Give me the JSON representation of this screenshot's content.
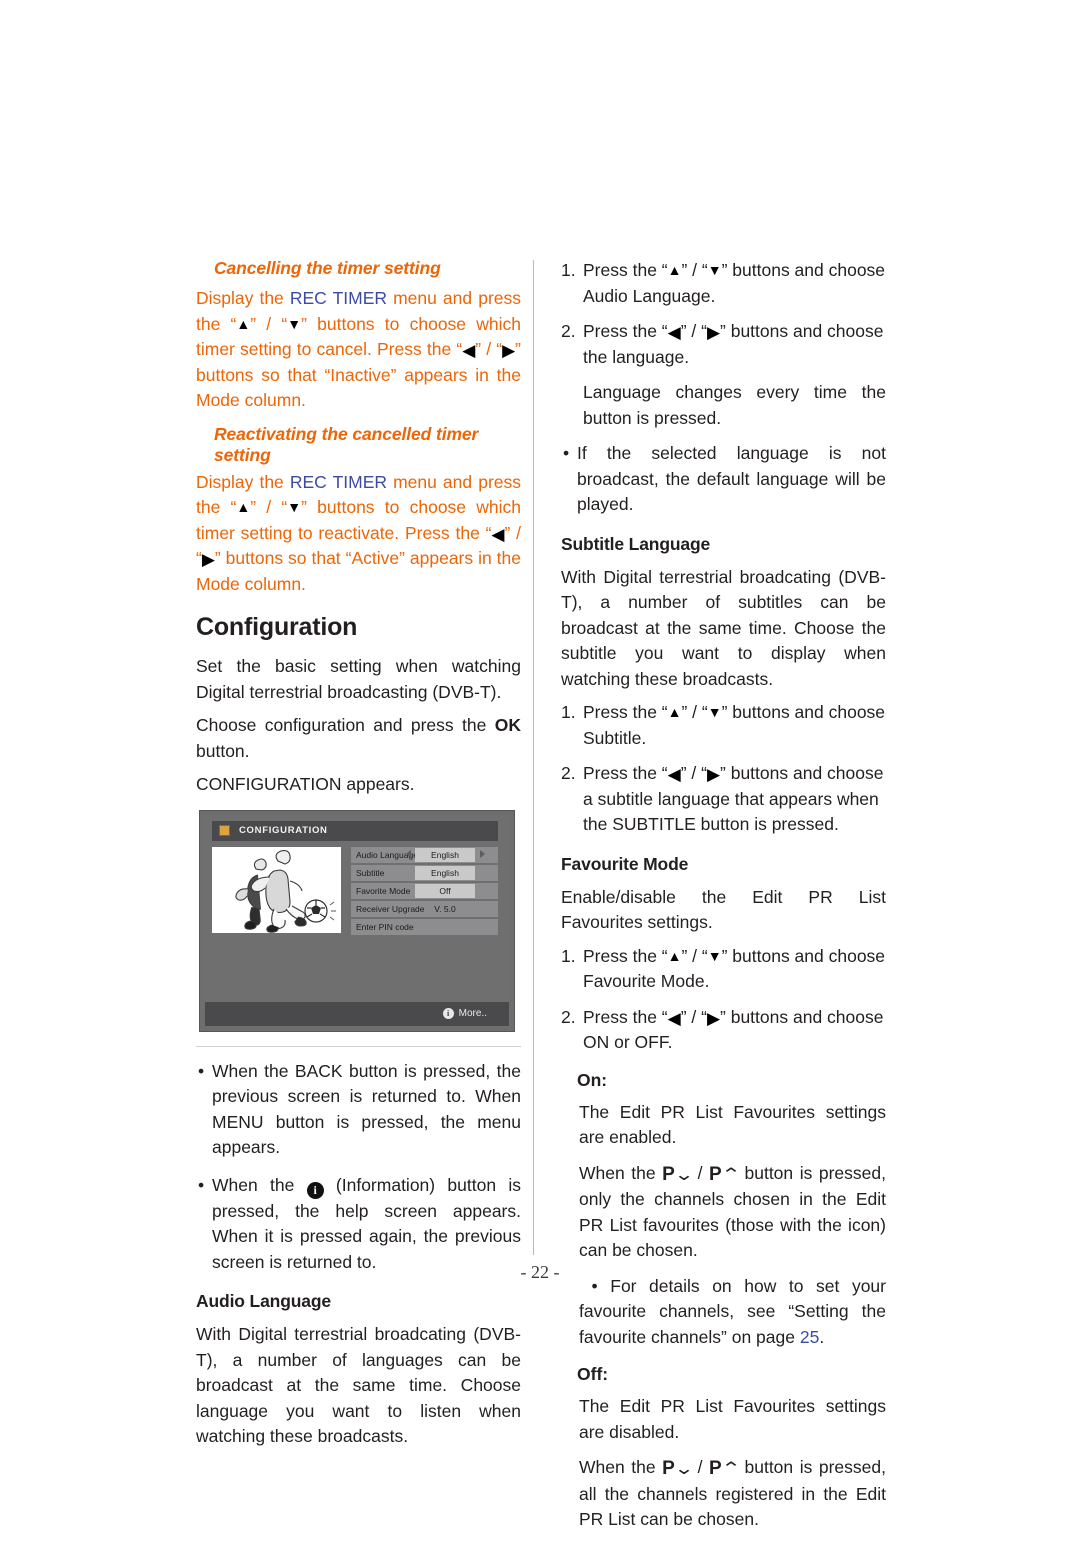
{
  "page": {
    "number_label": "- 22 -"
  },
  "left_column": {
    "cancel_heading": "Cancelling the timer setting",
    "cancel_body": {
      "p1": "Display the ",
      "rec_timer": "REC TIMER",
      "p2": " menu and press the “",
      "p3": "” / “",
      "p4": "” buttons to choose which timer setting to cancel. Press the “",
      "p5": "” / “",
      "p6": "” buttons so that “Inactive” appears in the Mode column."
    },
    "reactivate_heading": "Reactivating the cancelled  timer setting",
    "reactivate_body": {
      "p1": "Display the ",
      "rec_timer": "REC TIMER",
      "p2": " menu and press the “",
      "p3": "” / “",
      "p4": "” buttons to choose which timer setting to reactivate. Press the “",
      "p5": "” / “",
      "p6": "” buttons so that “Active” appears in the Mode column."
    },
    "configuration_title": "Configuration",
    "config_p1": "Set the basic setting when watching Digital terrestrial broadcasting (DVB-T).",
    "config_p2_a": "Choose configuration and press the ",
    "config_p2_ok": "OK",
    "config_p2_b": " button.",
    "config_p3": "CONFIGURATION appears.",
    "bullet_back_a": "When the BACK button is pressed, the previous screen is returned to. When MENU button is pressed, the menu appears.",
    "bullet_info_a": "When the ",
    "bullet_info_b": " (Information) button is pressed, the help screen appears. When it is pressed again, the previous screen is returned to.",
    "audio_language_heading": "Audio Language",
    "audio_language_body": "With Digital terrestrial broadcating (DVB-T), a number of languages can be broadcast at the same time. Choose language you want to listen when watching these broadcasts."
  },
  "screenshot": {
    "title": "CONFIGURATION",
    "title_icon": "key-icon",
    "rows": [
      {
        "label": "Audio Language",
        "value": "English",
        "has_arrows": true,
        "value_boxed": true
      },
      {
        "label": "Subtitle",
        "value": "English",
        "has_arrows": false,
        "value_boxed": true
      },
      {
        "label": "Favorite Mode",
        "value": "Off",
        "has_arrows": false,
        "value_boxed": true
      },
      {
        "label": "Receiver Upgrade",
        "value": "V. 5.0",
        "has_arrows": false,
        "value_boxed": false
      },
      {
        "label": "Enter PIN code",
        "value": "",
        "has_arrows": false,
        "value_boxed": false
      }
    ],
    "footer_label": "More..",
    "footer_icon": "info-icon",
    "artwork": "soccer-players-line-art"
  },
  "right_column": {
    "audio_step1_n": "1.",
    "audio_step1_a": "Press the “",
    "audio_step1_b": "” / “",
    "audio_step1_c": "” buttons and choose Audio Language.",
    "audio_step2_n": "2.",
    "audio_step2_a": "Press the “",
    "audio_step2_b": "” / “",
    "audio_step2_c": "” buttons and choose the language.",
    "audio_note": "Language changes every time the button is pressed.",
    "audio_bullet": "If the selected language is not broadcast, the default language will be played.",
    "subtitle_heading": "Subtitle Language",
    "subtitle_body": "With Digital terrestrial broadcating (DVB-T), a number of subtitles can be broadcast at the same time. Choose the subtitle you want to display when watching these broadcasts.",
    "sub_step1_n": "1.",
    "sub_step1_a": "Press the “",
    "sub_step1_b": "” / “",
    "sub_step1_c": "” buttons and choose Subtitle.",
    "sub_step2_n": "2.",
    "sub_step2_a": "Press the “",
    "sub_step2_b": "” / “",
    "sub_step2_c": "” buttons and choose a subtitle language that appears when the SUBTITLE button is pressed.",
    "favourite_heading": "Favourite Mode",
    "favourite_body": "Enable/disable the Edit PR List Favourites settings.",
    "fav_step1_n": "1.",
    "fav_step1_a": "Press the “",
    "fav_step1_b": "” / “",
    "fav_step1_c": "” buttons and choose Favourite Mode.",
    "fav_step2_n": "2.",
    "fav_step2_a": "Press the “",
    "fav_step2_b": "” / “",
    "fav_step2_c": "” buttons and choose ON or OFF.",
    "on_label": "On:",
    "on_body": "The Edit PR List Favourites settings are enabled.",
    "on_p_a": "When the ",
    "on_p_b": " button is pressed, only the channels chosen in the Edit PR List favourites (those with the icon) can be chosen.",
    "on_bullet_a": "For details on how to set your favourite channels, see “Setting the favourite channels” on page ",
    "on_bullet_page": "25",
    "on_bullet_b": ".",
    "off_label": "Off:",
    "off_body": "The Edit PR List Favourites settings are disabled.",
    "off_p_a": "When the ",
    "off_p_b": " button is pressed, all the channels registered in the Edit PR List can be chosen."
  }
}
